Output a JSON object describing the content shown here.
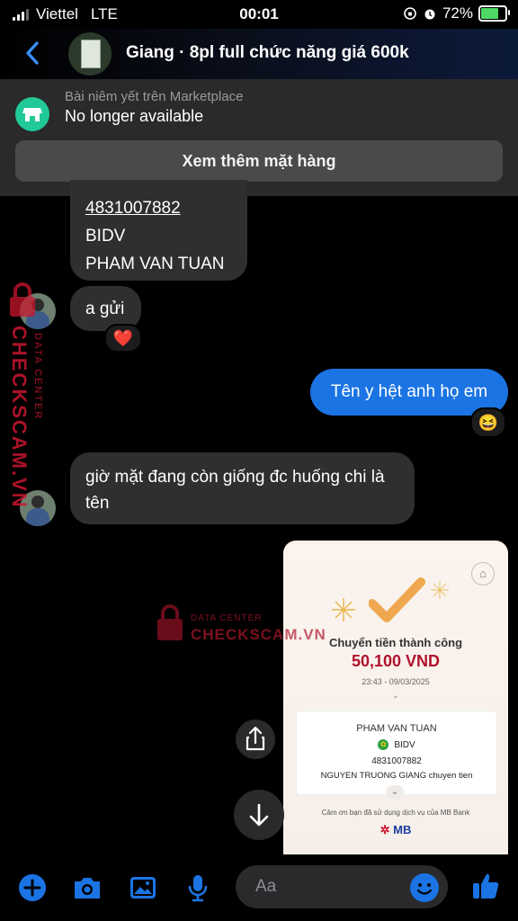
{
  "status_bar": {
    "carrier": "Viettel",
    "network": "LTE",
    "time": "00:01",
    "battery": "72%",
    "battery_level": 0.72
  },
  "header": {
    "title": "Giang · 8pl full chức năng giá 600k"
  },
  "marketplace": {
    "subtitle": "Bài niêm yết trên Marketplace",
    "status": "No longer available",
    "button_label": "Xem thêm mặt hàng"
  },
  "messages": {
    "bank_details": {
      "account_number": "4831007882",
      "bank": "BIDV",
      "name": "PHAM VAN TUAN"
    },
    "a_gui": "a gửi",
    "ten_y_het": "Tên y hệt anh họ em",
    "gio_mat": "giờ mặt đang còn giống đc huống chi là tên"
  },
  "reactions": {
    "heart": "❤️",
    "laugh": "😆"
  },
  "receipt": {
    "title": "Chuyển tiền thành công",
    "amount": "50,100 VND",
    "datetime": "23:43 - 09/03/2025",
    "recipient_name": "PHAM VAN TUAN",
    "bank": "BIDV",
    "account_number": "4831007882",
    "memo": "NGUYEN TRUONG GIANG chuyen tien",
    "thanks": "Cảm ơn bạn đã sử dụng dịch vụ của MB Bank",
    "brand": "MB"
  },
  "watermark": {
    "sub": "DATA CENTER",
    "main": "CHECKSCAM.VN"
  },
  "composer": {
    "placeholder": "Aa"
  },
  "colors": {
    "accent": "#1b74e4",
    "marketplace_icon": "#20c997",
    "bubble_incoming": "#2f2f31",
    "amount_red": "#b0122b",
    "watermark_red": "#c8162e"
  },
  "icons": {
    "back": "chevron-left-icon",
    "shop": "storefront-icon",
    "share": "share-icon",
    "scroll_down": "arrow-down-icon",
    "add": "plus-circle-icon",
    "camera": "camera-icon",
    "gallery": "image-icon",
    "mic": "microphone-icon",
    "emoji": "smiley-icon",
    "like": "thumbs-up-icon"
  }
}
